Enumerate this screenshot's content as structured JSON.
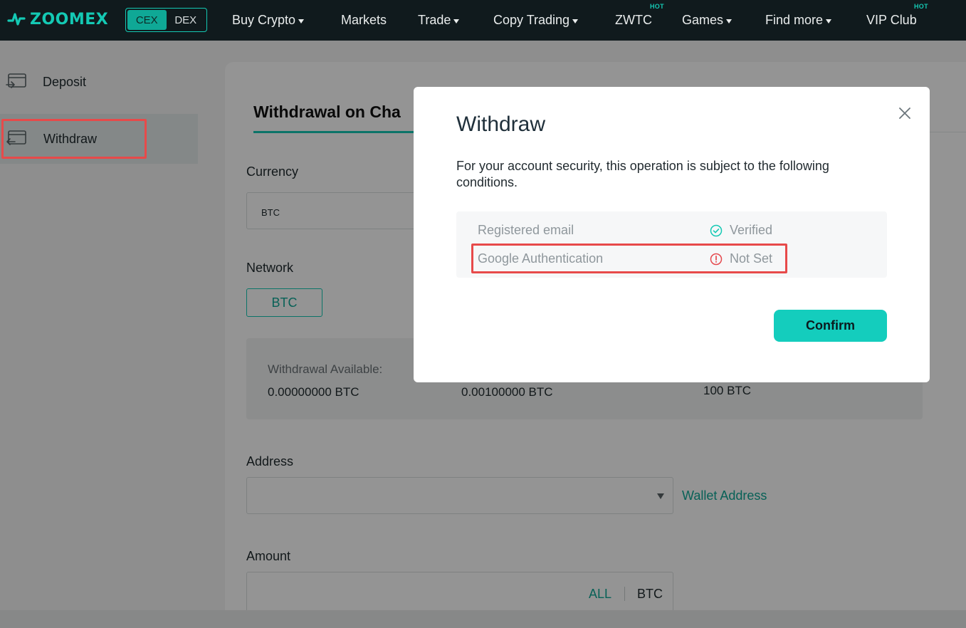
{
  "brand": {
    "name": "ZOOMEX",
    "color": "#14c9b4"
  },
  "mode_switch": {
    "options": [
      "CEX",
      "DEX"
    ],
    "active": "CEX"
  },
  "nav": {
    "items": [
      {
        "label": "Buy Crypto",
        "dropdown": true
      },
      {
        "label": "Markets",
        "dropdown": false
      },
      {
        "label": "Trade",
        "dropdown": true
      },
      {
        "label": "Copy Trading",
        "dropdown": true
      },
      {
        "label": "ZWTC",
        "dropdown": false,
        "badge": "HOT"
      },
      {
        "label": "Games",
        "dropdown": true
      },
      {
        "label": "Find more",
        "dropdown": true
      },
      {
        "label": "VIP Club",
        "dropdown": false,
        "badge": "HOT"
      }
    ]
  },
  "sidebar": {
    "items": [
      {
        "label": "Deposit",
        "icon": "deposit-icon"
      },
      {
        "label": "Withdraw",
        "icon": "withdraw-icon",
        "active": true
      }
    ]
  },
  "main": {
    "tab_title": "Withdrawal on Cha",
    "currency": {
      "label": "Currency",
      "value": "BTC"
    },
    "network": {
      "label": "Network",
      "option": "BTC"
    },
    "availability": {
      "label": "Withdrawal Available:",
      "available_value": "0.00000000 BTC",
      "second_value": "0.00100000 BTC",
      "third_value": "100 BTC"
    },
    "address": {
      "label": "Address",
      "link": "Wallet Address"
    },
    "amount": {
      "label": "Amount",
      "all": "ALL",
      "unit": "BTC"
    }
  },
  "modal": {
    "title": "Withdraw",
    "description": "For your account security, this operation is subject to the following conditions.",
    "conditions": [
      {
        "name": "Registered email",
        "status": "Verified",
        "status_icon": "check-circle-icon",
        "status_color": "#14c9b4"
      },
      {
        "name": "Google Authentication",
        "status": "Not Set",
        "status_icon": "alert-circle-icon",
        "status_color": "#e5484d"
      }
    ],
    "confirm_label": "Confirm"
  },
  "highlight_color": "#e74a4a"
}
